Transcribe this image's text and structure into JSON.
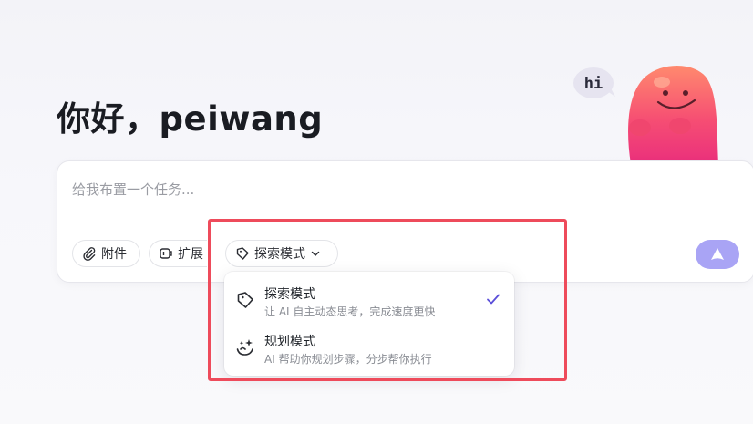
{
  "greeting": "你好，peiwang",
  "mascot": {
    "speech": "hi"
  },
  "input": {
    "placeholder": "给我布置一个任务..."
  },
  "toolbar": {
    "attach_label": "附件",
    "extend_label": "扩展",
    "mode_label": "探索模式"
  },
  "mode_menu": {
    "options": [
      {
        "title": "探索模式",
        "desc": "让 AI 自主动态思考，完成速度更快",
        "selected": true,
        "icon": "explore-tag-icon"
      },
      {
        "title": "规划模式",
        "desc": "AI 帮助你规划步骤，分步帮你执行",
        "selected": false,
        "icon": "plan-sparkle-icon"
      }
    ]
  },
  "colors": {
    "accent": "#5b4fd9",
    "send_button": "#a9a4f5",
    "highlight": "#ee4b5b"
  }
}
